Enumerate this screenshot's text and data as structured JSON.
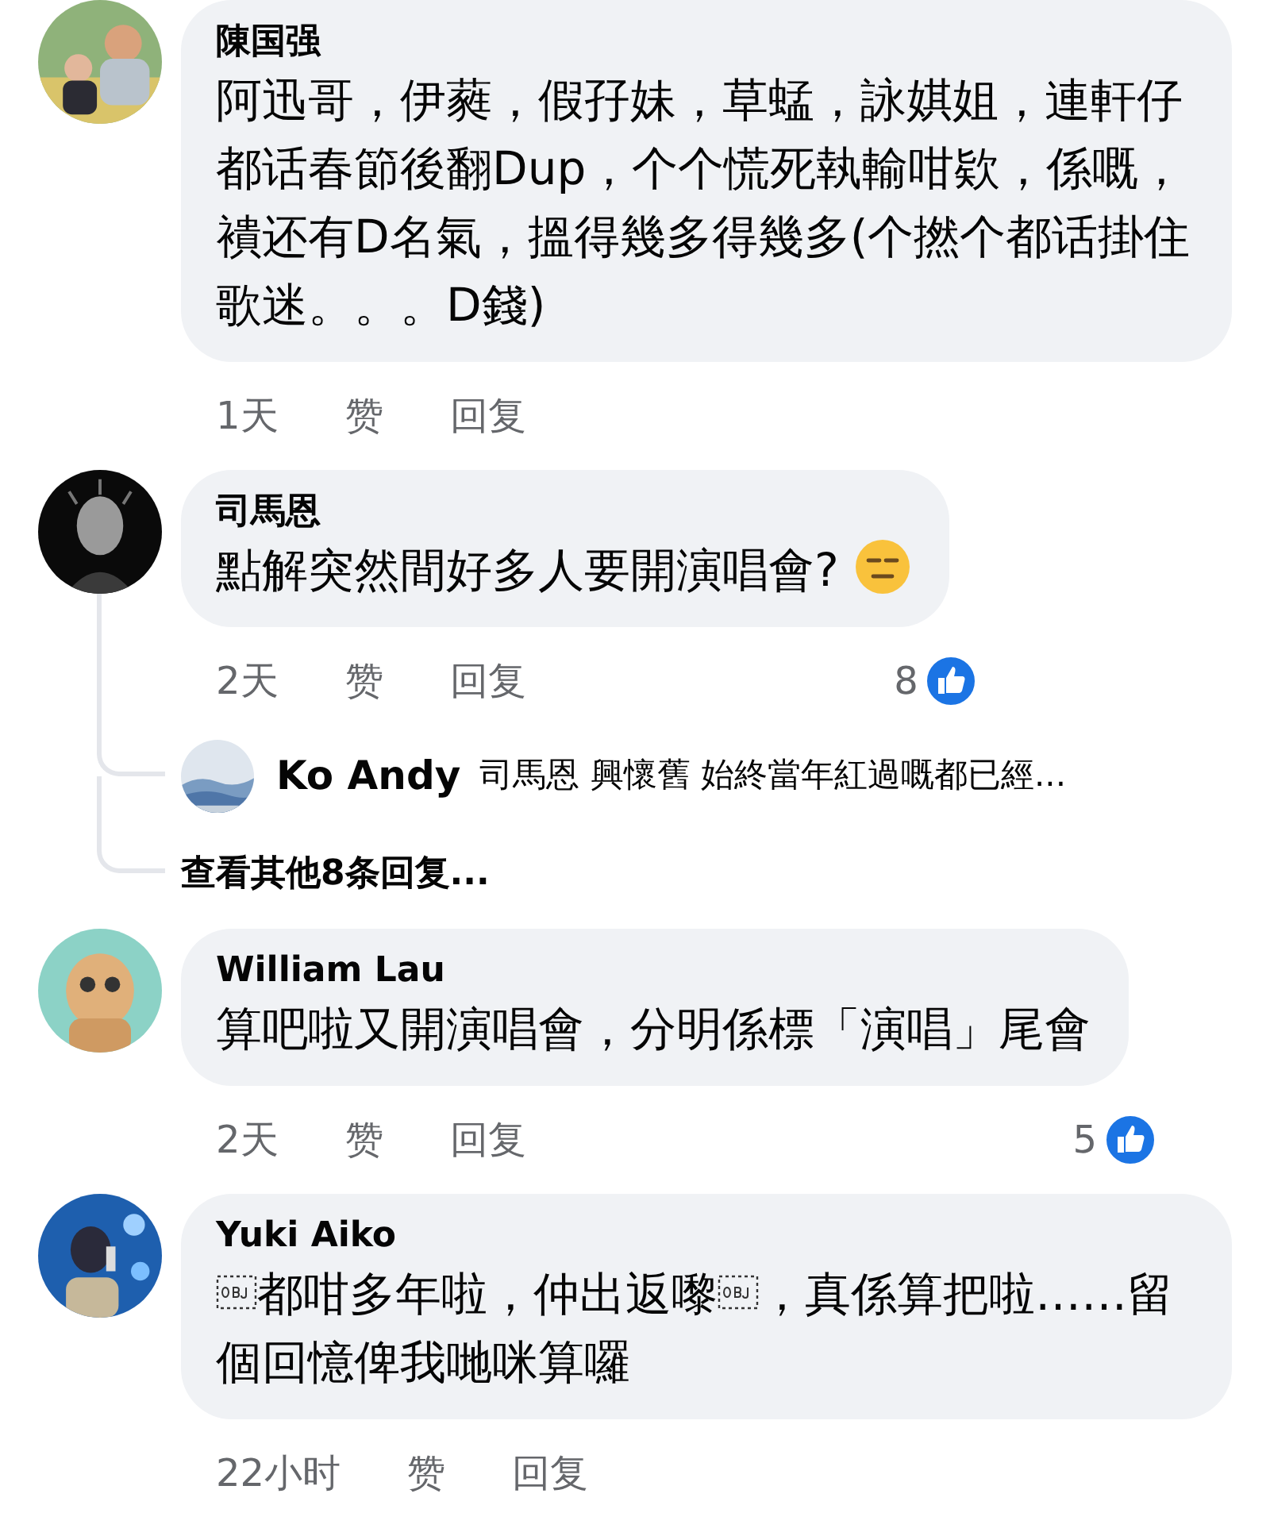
{
  "comments": [
    {
      "author": "陳国强",
      "segments": [
        {
          "kind": "text",
          "text": "阿迅哥，伊蕤，假孖妹，草蜢，詠娸姐，連軒仔都话春節後翻Dup，个个慌死執輸咁欵，係嘅，䙡还有D名氣，搵得幾多得幾多(个撚个都话掛住歌迷。。。D錢)"
        }
      ],
      "emoji": false,
      "time": "1天",
      "like": "赞",
      "reply": "回复"
    },
    {
      "author": "司馬恩",
      "segments": [
        {
          "kind": "text",
          "text": "點解突然間好多人要開演唱會?"
        }
      ],
      "emoji": true,
      "time": "2天",
      "like": "赞",
      "reply": "回复",
      "like_count": "8",
      "replies": [
        {
          "author": "Ko Andy",
          "text": "司馬恩 興懷舊 始終當年紅過嘅都已經..."
        }
      ],
      "more_replies": "查看其他8条回复..."
    },
    {
      "author": "William Lau",
      "segments": [
        {
          "kind": "text",
          "text": "算吧啦又開演唱會，分明係標「演唱」尾會"
        }
      ],
      "emoji": false,
      "time": "2天",
      "like": "赞",
      "reply": "回复",
      "like_count": "5"
    },
    {
      "author": "Yuki Aiko",
      "segments": [
        {
          "kind": "object"
        },
        {
          "kind": "text",
          "text": "都咁多年啦，仲出返嚟"
        },
        {
          "kind": "object"
        },
        {
          "kind": "text",
          "text": "，真係算把啦……留個回憶俾我哋咪算囉"
        }
      ],
      "emoji": false,
      "time": "22小时",
      "like": "赞",
      "reply": "回复"
    }
  ]
}
